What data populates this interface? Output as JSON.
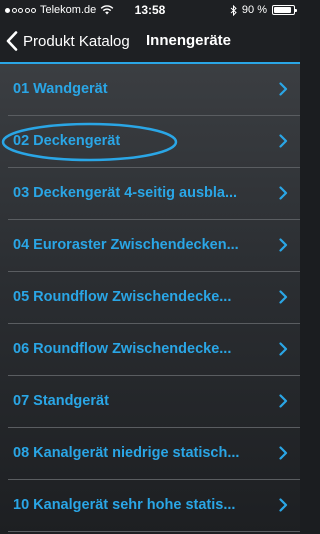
{
  "status_bar": {
    "carrier": "Telekom.de",
    "time": "13:58",
    "battery_percent": "90 %",
    "battery_level": 0.9,
    "signal_bars_filled": 1,
    "signal_bars_total": 5,
    "icons": [
      "wifi-icon",
      "bluetooth-icon",
      "battery-icon"
    ]
  },
  "nav": {
    "back_label": "Produkt Katalog",
    "title": "Innengeräte",
    "icons": [
      "back-chevron-icon"
    ]
  },
  "list": {
    "items": [
      {
        "label": "01 Wandgerät"
      },
      {
        "label": "02 Deckengerät"
      },
      {
        "label": "03 Deckengerät 4-seitig ausbla..."
      },
      {
        "label": "04 Euroraster Zwischendecken..."
      },
      {
        "label": "05 Roundflow Zwischendecke..."
      },
      {
        "label": "06 Roundflow Zwischendecke..."
      },
      {
        "label": "07 Standgerät"
      },
      {
        "label": "08 Kanalgerät niedrige statisch..."
      },
      {
        "label": "10 Kanalgerät sehr hohe statis..."
      }
    ],
    "row_icon": "chevron-right-icon"
  },
  "colors": {
    "accent": "#2aa6e6",
    "bar_background": "#1e2023",
    "separator": "#5a5d61"
  }
}
